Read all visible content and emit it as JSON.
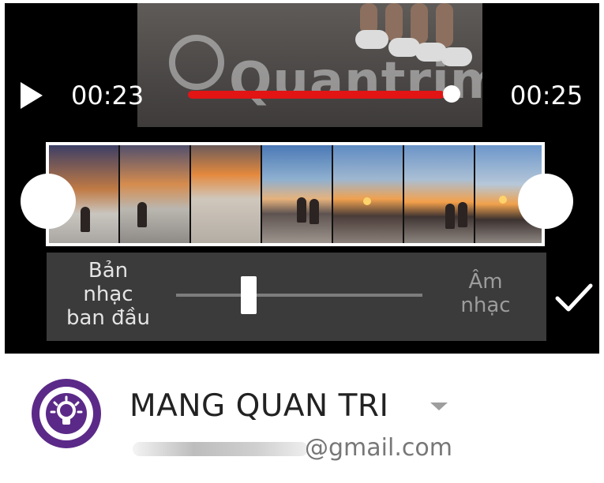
{
  "player": {
    "current_time": "00:23",
    "end_time": "00:25",
    "watermark": "Quantrimang",
    "seek_progress": 0.95
  },
  "trim": {
    "thumbnail_count": 7
  },
  "audio_mix": {
    "left_label_lines": [
      "Bản",
      "nhạc",
      "ban đầu"
    ],
    "right_label_lines": [
      "Âm",
      "nhạc"
    ],
    "slider_value": 0.3
  },
  "account": {
    "name": "MANG QUAN TRI",
    "email_domain": "@gmail.com"
  },
  "colors": {
    "seek_bar": "#e21414",
    "avatar_brand": "#5b2a88",
    "editor_background": "#000000",
    "mix_panel": "#3b3b3b"
  },
  "icons": {
    "play": "play-icon",
    "confirm": "check-icon",
    "account_menu": "chevron-down-icon",
    "avatar": "lightbulb-logo-icon"
  }
}
